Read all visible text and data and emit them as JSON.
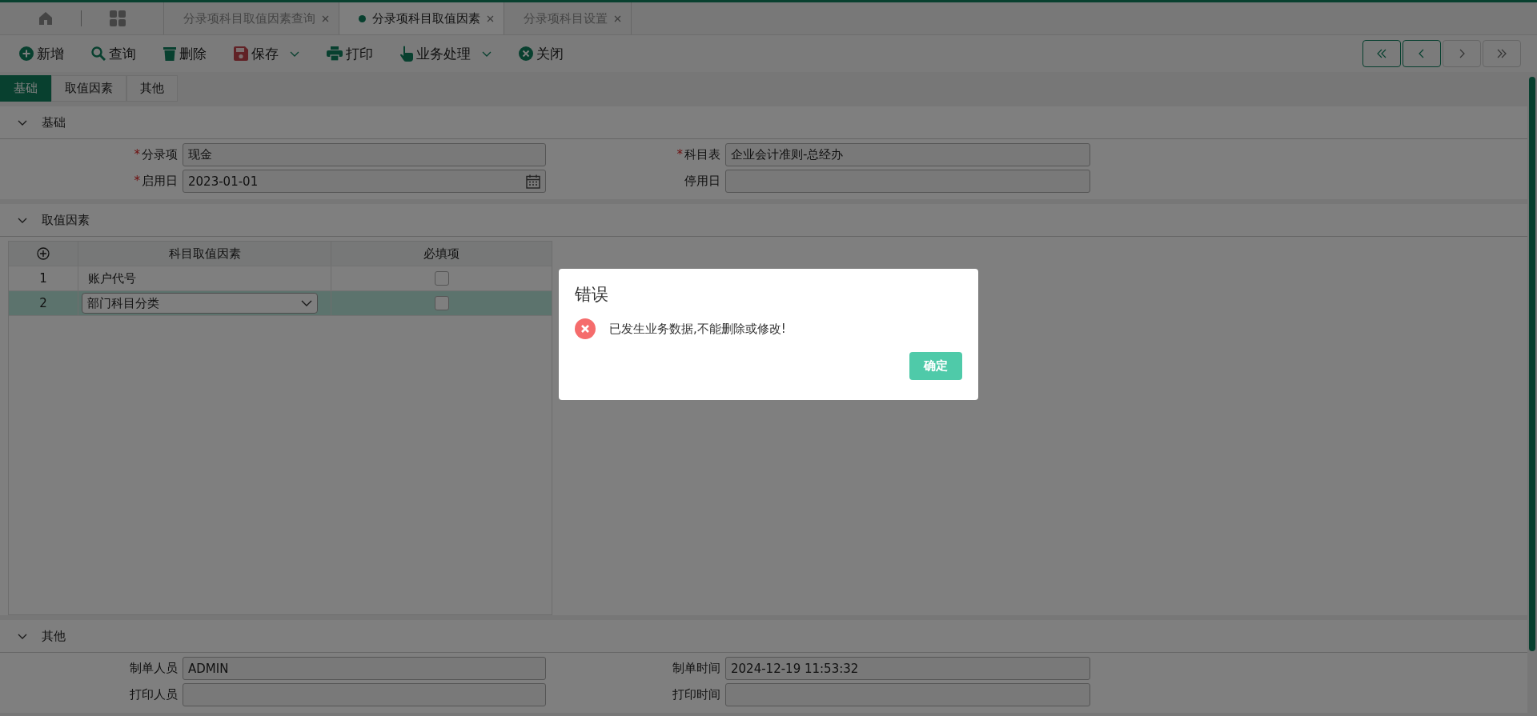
{
  "top_tabs": [
    {
      "label": "分录项科目取值因素查询",
      "selected": false
    },
    {
      "label": "分录项科目取值因素",
      "selected": true
    },
    {
      "label": "分录项科目设置",
      "selected": false
    }
  ],
  "toolbar": [
    {
      "kind": "add",
      "label": "新增",
      "dropdown": false
    },
    {
      "kind": "search",
      "label": "查询",
      "dropdown": false
    },
    {
      "kind": "delete",
      "label": "删除",
      "dropdown": false
    },
    {
      "kind": "save",
      "label": "保存",
      "dropdown": true
    },
    {
      "kind": "print",
      "label": "打印",
      "dropdown": false
    },
    {
      "kind": "process",
      "label": "业务处理",
      "dropdown": true
    },
    {
      "kind": "close",
      "label": "关闭",
      "dropdown": false
    }
  ],
  "nav_buttons": [
    {
      "kind": "first",
      "disabled": false
    },
    {
      "kind": "prev",
      "disabled": false
    },
    {
      "kind": "next",
      "disabled": true
    },
    {
      "kind": "last",
      "disabled": true
    }
  ],
  "form_tabs": [
    {
      "label": "基础",
      "selected": true
    },
    {
      "label": "取值因素",
      "selected": false
    },
    {
      "label": "其他",
      "selected": false
    }
  ],
  "basic_section": {
    "title": "基础",
    "fields": [
      {
        "label": "分录项",
        "required": true,
        "kind": "text",
        "value": "现金"
      },
      {
        "label": "科目表",
        "required": true,
        "kind": "text",
        "value": "企业会计准则-总经办"
      },
      {
        "label": "启用日",
        "required": true,
        "kind": "date",
        "value": "2023-01-01"
      },
      {
        "label": "停用日",
        "required": false,
        "kind": "text"
      }
    ]
  },
  "factor_section": {
    "title": "取值因素",
    "columns": [
      "科目取值因素",
      "必填项"
    ],
    "rows": [
      {
        "no": "1",
        "factor": "账户代号",
        "kind": "text",
        "checked": false,
        "selected": false
      },
      {
        "no": "2",
        "factor": "部门科目分类",
        "kind": "select",
        "checked": false,
        "selected": true
      }
    ]
  },
  "other_section": {
    "title": "其他",
    "fields": [
      {
        "label": "制单人员",
        "required": false,
        "value": "ADMIN"
      },
      {
        "label": "制单时间",
        "required": false,
        "value": "2024-12-19 11:53:32"
      },
      {
        "label": "打印人员",
        "required": false
      },
      {
        "label": "打印时间",
        "required": false
      }
    ]
  },
  "required_mark": "*",
  "dialog": {
    "title": "错误",
    "message": "已发生业务数据,不能删除或修改!",
    "button": "确定"
  }
}
